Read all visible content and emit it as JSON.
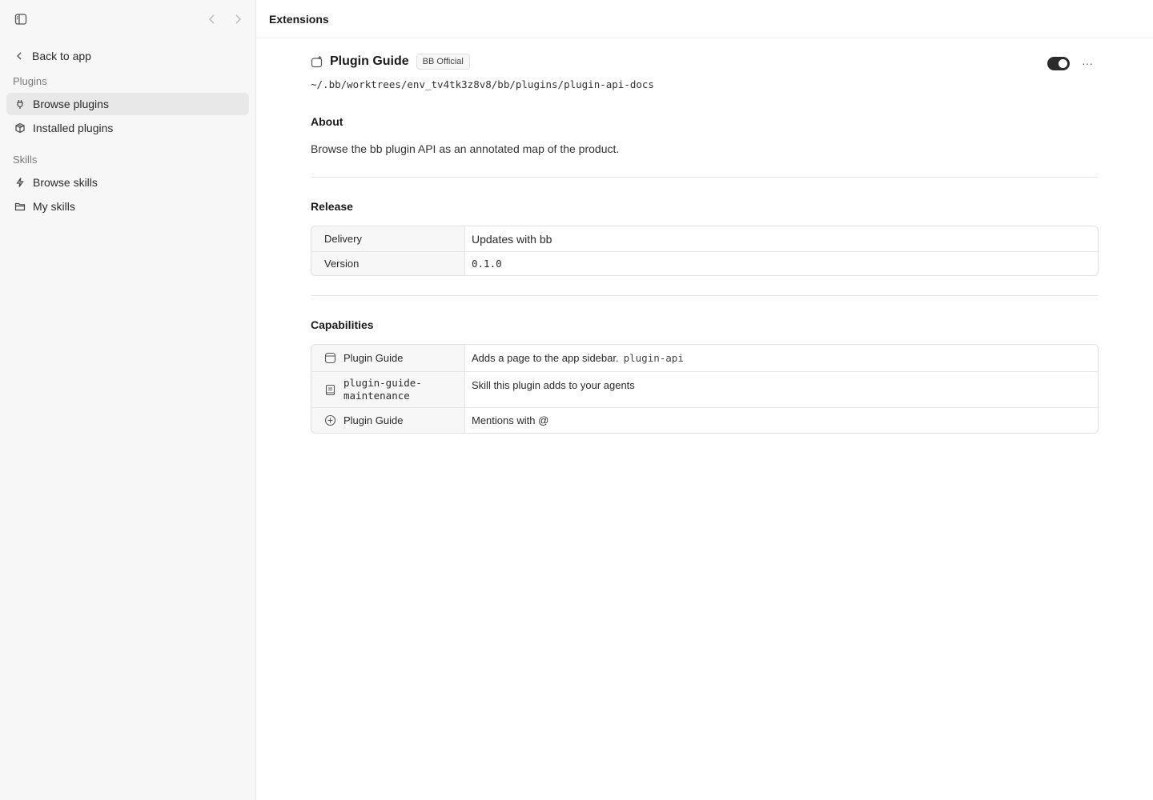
{
  "sidebar": {
    "back_label": "Back to app",
    "plugins_section": "Plugins",
    "skills_section": "Skills",
    "items": [
      {
        "label": "Browse plugins",
        "icon": "plug-icon",
        "active": true
      },
      {
        "label": "Installed plugins",
        "icon": "package-icon",
        "active": false
      },
      {
        "label": "Browse skills",
        "icon": "bolt-icon",
        "active": false
      },
      {
        "label": "My skills",
        "icon": "folder-icon",
        "active": false
      }
    ]
  },
  "topbar": {
    "title": "Extensions"
  },
  "plugin": {
    "name": "Plugin Guide",
    "badge": "BB Official",
    "path": "~/.bb/worktrees/env_tv4tk3z8v8/bb/plugins/plugin-api-docs",
    "enabled": true,
    "more_label": "···"
  },
  "about": {
    "title": "About",
    "text": "Browse the bb plugin API as an annotated map of the product."
  },
  "release": {
    "title": "Release",
    "rows": [
      {
        "key": "Delivery",
        "value": "Updates with bb"
      },
      {
        "key": "Version",
        "value": "0.1.0"
      }
    ]
  },
  "capabilities": {
    "title": "Capabilities",
    "rows": [
      {
        "icon": "page-icon",
        "name": "Plugin Guide",
        "desc": "Adds a page to the app sidebar.",
        "tag": "plugin-api"
      },
      {
        "icon": "book-icon",
        "name_line1": "plugin-guide-",
        "name_line2": "maintenance",
        "desc": "Skill this plugin adds to your agents"
      },
      {
        "icon": "mention-icon",
        "name": "Plugin Guide",
        "desc": "Mentions with @"
      }
    ]
  }
}
